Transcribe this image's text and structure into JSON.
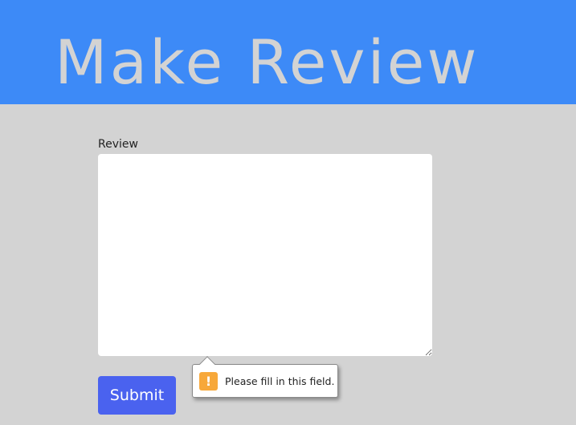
{
  "header": {
    "title": "Make Review"
  },
  "form": {
    "review_label": "Review",
    "review_value": "",
    "submit_label": "Submit"
  },
  "validation_tooltip": {
    "icon": "exclamation-icon",
    "message": "Please fill in this field."
  },
  "colors": {
    "header_bg": "#3d8af7",
    "page_bg": "#d3d3d3",
    "title_text": "#d3d3d3",
    "submit_bg": "#4a62ef",
    "warning_icon": "#f7a83a"
  }
}
